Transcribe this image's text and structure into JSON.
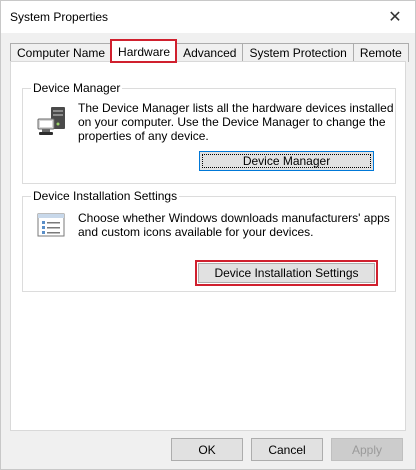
{
  "window": {
    "title": "System Properties",
    "close_icon": "close-icon"
  },
  "tabs": [
    {
      "label": "Computer Name",
      "active": false
    },
    {
      "label": "Hardware",
      "active": true
    },
    {
      "label": "Advanced",
      "active": false
    },
    {
      "label": "System Protection",
      "active": false
    },
    {
      "label": "Remote",
      "active": false
    }
  ],
  "device_manager": {
    "title": "Device Manager",
    "icon": "device-manager-icon",
    "description_lines": [
      "The Device Manager lists all the hardware devices installed",
      "on your computer. Use the Device Manager to change the",
      "properties of any device."
    ],
    "button_label": "Device Manager"
  },
  "device_installation": {
    "title": "Device Installation Settings",
    "icon": "checklist-icon",
    "description_lines": [
      "Choose whether Windows downloads manufacturers' apps",
      "and custom icons available for your devices."
    ],
    "button_label": "Device Installation Settings"
  },
  "footer": {
    "ok_label": "OK",
    "cancel_label": "Cancel",
    "apply_label": "Apply"
  },
  "colors": {
    "highlight": "#d0202e",
    "focus_border": "#0078d7"
  }
}
